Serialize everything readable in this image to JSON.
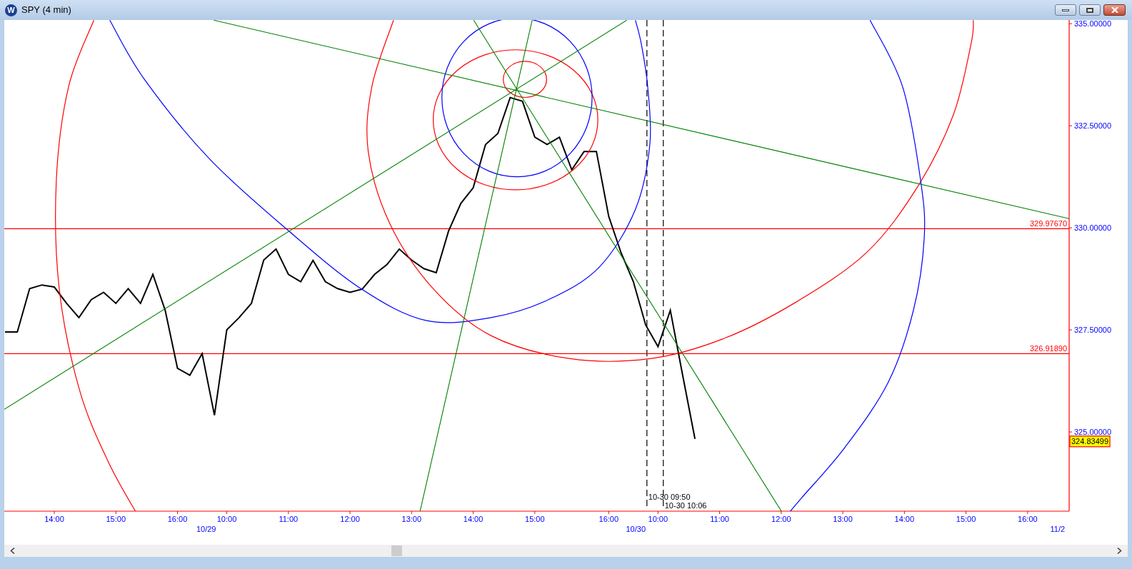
{
  "window": {
    "title": "SPY (4 min)",
    "icon_text": "W"
  },
  "chart": {
    "chart_data": {
      "type": "line",
      "categories": [
        null,
        null,
        null,
        null,
        "14:00",
        null,
        null,
        null,
        null,
        "15:00",
        null,
        null,
        null,
        null,
        "16:00",
        null,
        null,
        null,
        "10:00",
        null,
        null,
        null,
        null,
        "11:00",
        null,
        null,
        null,
        null,
        "12:00",
        null,
        null,
        null,
        null,
        "13:00",
        null,
        null,
        null,
        null,
        "14:00",
        null,
        null,
        null,
        null,
        "15:00",
        null,
        null,
        null,
        null,
        null,
        "16:00",
        null,
        null,
        null,
        "10:00",
        null,
        null,
        null,
        null,
        "11:00",
        null,
        null,
        null,
        null,
        "12:00",
        null,
        null,
        null,
        null,
        "13:00",
        null,
        null,
        null,
        null,
        "14:00",
        null,
        null,
        null,
        null,
        "15:00",
        null,
        null,
        null,
        null,
        "16:00",
        null,
        null,
        null
      ],
      "series": [
        {
          "color": "#000000",
          "values": [
            327.45,
            327.45,
            328.51,
            328.6,
            328.55,
            328.15,
            327.8,
            328.24,
            328.42,
            328.15,
            328.51,
            328.15,
            328.86,
            327.98,
            326.56,
            326.39,
            326.92,
            325.41,
            327.5,
            327.8,
            328.15,
            329.21,
            329.48,
            328.86,
            328.68,
            329.2,
            328.68,
            328.51,
            328.42,
            328.5,
            328.86,
            329.1,
            329.48,
            329.21,
            329.0,
            328.9,
            329.92,
            330.6,
            330.98,
            332.04,
            332.31,
            333.19,
            333.1,
            332.22,
            332.04,
            332.22,
            331.42,
            331.87,
            331.87,
            330.28,
            329.39,
            328.68,
            327.62,
            327.09,
            327.98,
            326.39,
            324.83,
            null,
            null,
            null,
            null,
            null,
            null,
            null,
            null,
            null,
            null,
            null,
            null,
            null,
            null,
            null,
            null,
            null,
            null,
            null,
            null,
            null,
            null,
            null,
            null,
            null,
            null,
            null,
            null,
            null,
            null
          ]
        }
      ],
      "ylim": [
        323.06,
        335.09
      ],
      "yticks": [
        {
          "value": 335,
          "label": "335.00000"
        },
        {
          "value": 332.5,
          "label": "332.50000"
        },
        {
          "value": 330,
          "label": "330.00000"
        },
        {
          "value": 327.5,
          "label": "327.50000"
        },
        {
          "value": 325,
          "label": "325.00000"
        }
      ],
      "ref_lines": [
        {
          "axis": "y",
          "value": 329.9767,
          "label": "329.97670",
          "color": "#ff0000"
        },
        {
          "axis": "y",
          "value": 326.9189,
          "label": "326.91890",
          "color": "#ff0000"
        }
      ],
      "annotations": [
        "324.83499"
      ]
    },
    "date_labels": [
      "10/29",
      "10/30",
      "11/2"
    ],
    "time_markers": [
      "10-30 09:50",
      "10-30 10:06"
    ]
  }
}
